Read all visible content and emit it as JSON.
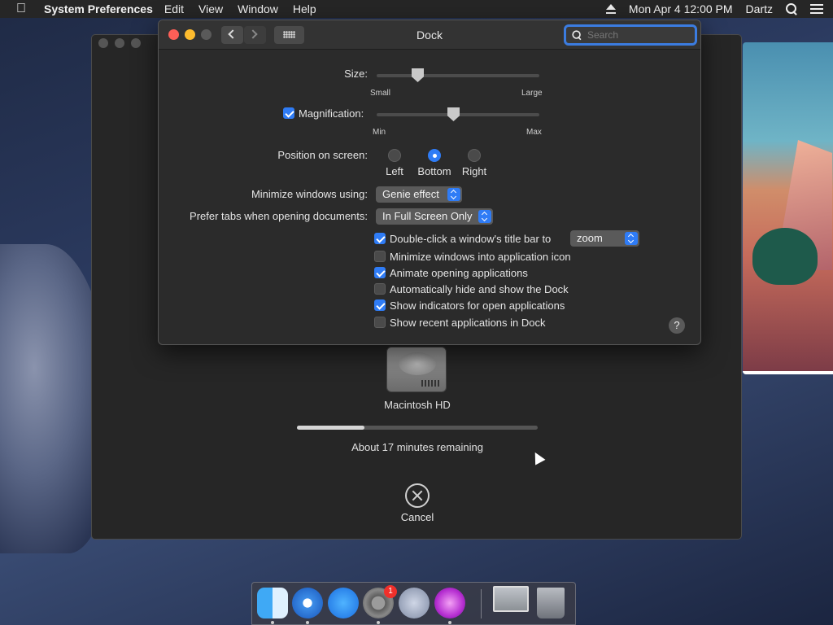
{
  "menubar": {
    "app_name": "System Preferences",
    "menus": [
      "Edit",
      "View",
      "Window",
      "Help"
    ],
    "clock": "Mon Apr 4  12:00 PM",
    "user": "Dartz",
    "icons": [
      "apple-icon",
      "eject-icon",
      "spotlight-icon",
      "notification-center-icon"
    ]
  },
  "installer": {
    "disk_label": "Macintosh HD",
    "progress": 0.28,
    "remaining": "About 17 minutes remaining",
    "cancel_label": "Cancel"
  },
  "prefs": {
    "title": "Dock",
    "search_placeholder": "Search",
    "size": {
      "label": "Size:",
      "min_label": "Small",
      "max_label": "Large",
      "value": 0.25
    },
    "magnification": {
      "label": "Magnification:",
      "checked": true,
      "min_label": "Min",
      "max_label": "Max",
      "value": 0.47
    },
    "position": {
      "label": "Position on screen:",
      "options": [
        "Left",
        "Bottom",
        "Right"
      ],
      "selected": "Bottom"
    },
    "minimize_using": {
      "label": "Minimize windows using:",
      "value": "Genie effect"
    },
    "prefer_tabs": {
      "label": "Prefer tabs when opening documents:",
      "value": "In Full Screen Only"
    },
    "double_click": {
      "label": "Double-click a window's title bar to",
      "checked": true,
      "value": "zoom"
    },
    "checkboxes": [
      {
        "label": "Minimize windows into application icon",
        "checked": false
      },
      {
        "label": "Animate opening applications",
        "checked": true
      },
      {
        "label": "Automatically hide and show the Dock",
        "checked": false
      },
      {
        "label": "Show indicators for open applications",
        "checked": true
      },
      {
        "label": "Show recent applications in Dock",
        "checked": false
      }
    ],
    "help_label": "?"
  },
  "dock": {
    "apps": [
      "Finder",
      "Safari",
      "App Store",
      "System Preferences",
      "Launchpad",
      "Install macOS",
      "Preview",
      "Trash"
    ],
    "badge": "1"
  }
}
